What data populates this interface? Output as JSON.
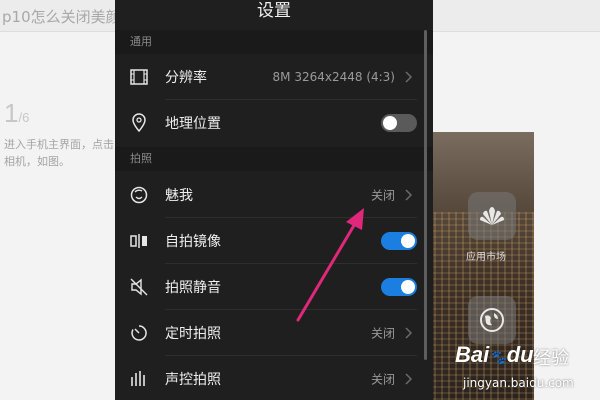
{
  "background": {
    "title": "p10怎么关闭美颜",
    "step": "1",
    "step_total": "/6",
    "step_text": "进入手机主界面，点击相机，如图。",
    "app_tiles": [
      {
        "label": "应用市场",
        "icon": "huawei-logo-icon"
      },
      {
        "label": "",
        "icon": "browser-globe-icon"
      }
    ]
  },
  "settings": {
    "title": "设置",
    "sections": [
      {
        "header": "通用"
      },
      {
        "header": "拍照"
      }
    ],
    "rows": {
      "resolution": {
        "label": "分辨率",
        "value": "8M 3264x2448 (4:3)",
        "icon": "resolution-icon"
      },
      "location": {
        "label": "地理位置",
        "toggle": "off",
        "icon": "location-pin-icon"
      },
      "beauty": {
        "label": "魅我",
        "value": "关闭",
        "icon": "beauty-face-icon"
      },
      "mirror": {
        "label": "自拍镜像",
        "toggle": "on",
        "icon": "mirror-icon"
      },
      "mute": {
        "label": "拍照静音",
        "toggle": "on",
        "icon": "speaker-mute-icon"
      },
      "timer": {
        "label": "定时拍照",
        "value": "关闭",
        "icon": "timer-icon"
      },
      "voice": {
        "label": "声控拍照",
        "value": "关闭",
        "icon": "voice-bars-icon"
      }
    }
  },
  "colors": {
    "panel_bg": "#1f1f1f",
    "toggle_on": "#1a7fe0",
    "toggle_off": "#5a5a5a",
    "arrow": "#e0287a"
  },
  "watermark": {
    "brand": "Bai",
    "brand_suffix": "du",
    "text": "经验",
    "url": "jingyan.baidu.com"
  }
}
